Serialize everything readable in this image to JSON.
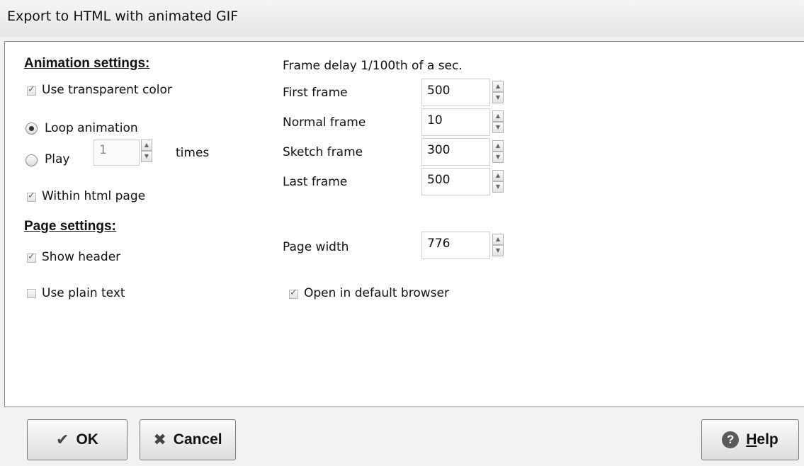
{
  "window": {
    "title": "Export to HTML with animated GIF"
  },
  "animation": {
    "heading": "Animation settings:",
    "use_transparent": {
      "label": "Use transparent color",
      "checked": true
    },
    "loop": {
      "label": "Loop animation",
      "selected": true
    },
    "play": {
      "label": "Play",
      "count": "1",
      "suffix": "times",
      "selected": false
    },
    "within_html": {
      "label": "Within html page",
      "checked": true
    }
  },
  "frames": {
    "heading": "Frame delay 1/100th of a sec.",
    "first": {
      "label": "First frame",
      "value": "500"
    },
    "normal": {
      "label": "Normal frame",
      "value": "10"
    },
    "sketch": {
      "label": "Sketch frame",
      "value": "300"
    },
    "last": {
      "label": "Last frame",
      "value": "500"
    }
  },
  "page": {
    "heading": "Page settings:",
    "show_header": {
      "label": "Show header",
      "checked": true
    },
    "plain_text": {
      "label": "Use plain text",
      "checked": false
    },
    "width": {
      "label": "Page width",
      "value": "776"
    },
    "open_browser": {
      "label": "Open in default browser",
      "checked": true
    }
  },
  "buttons": {
    "ok": "OK",
    "cancel": "Cancel",
    "help_mnemonic": "H",
    "help_rest": "elp"
  },
  "icons": {
    "ok": "checkmark-icon",
    "cancel": "x-icon",
    "help": "help-icon"
  }
}
